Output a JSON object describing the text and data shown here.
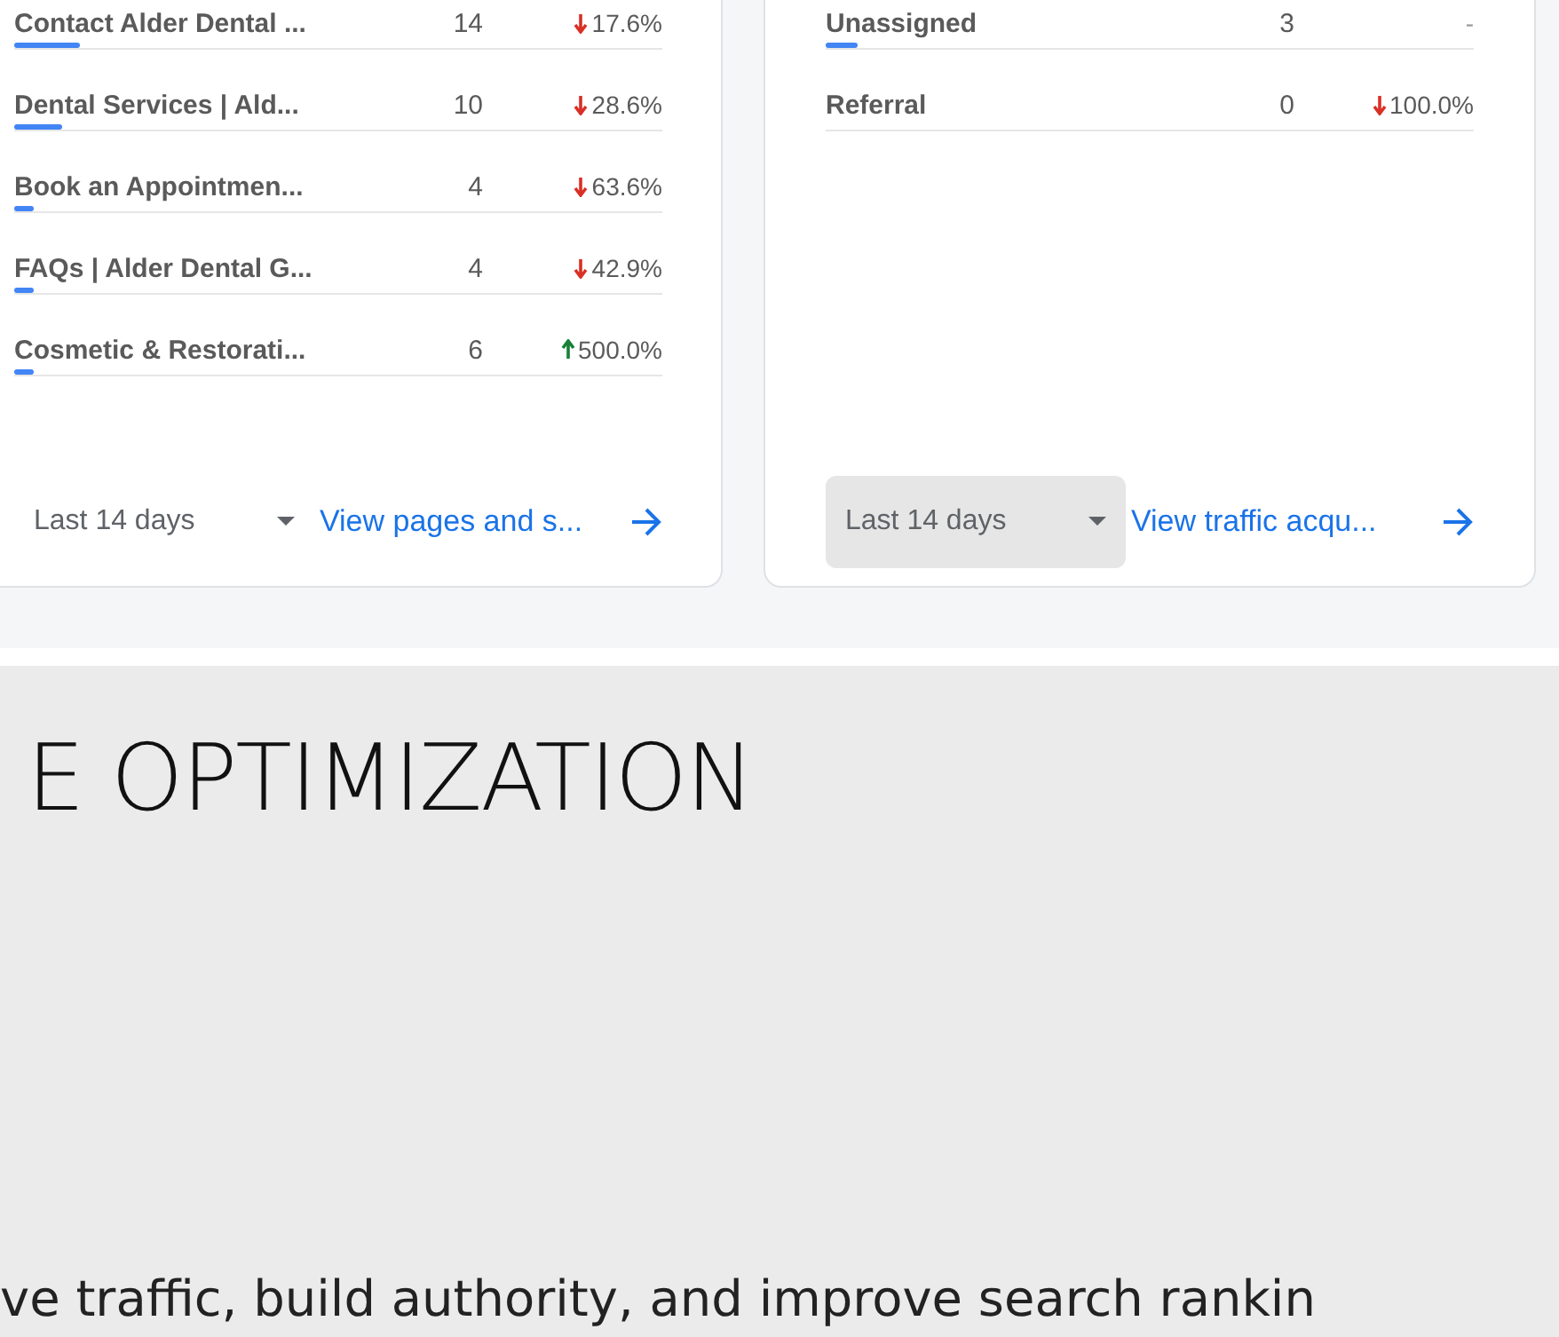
{
  "cards": [
    {
      "rows": [
        {
          "name": "Contact Alder Dental ...",
          "value": "14",
          "change": "17.6%",
          "kind": "down",
          "level": 0.1
        },
        {
          "name": "Dental Services | Ald...",
          "value": "10",
          "change": "28.6%",
          "kind": "down",
          "level": 0.075
        },
        {
          "name": "Book an Appointmen...",
          "value": "4",
          "change": "63.6%",
          "kind": "down",
          "level": 0.03
        },
        {
          "name": "FAQs | Alder Dental G...",
          "value": "4",
          "change": "42.9%",
          "kind": "down",
          "level": 0.03
        },
        {
          "name": "Cosmetic & Restorati...",
          "value": "6",
          "change": "500.0%",
          "kind": "up",
          "level": 0.03
        }
      ],
      "period": {
        "label": "Last 14 days",
        "highlighted": false
      },
      "link": "View pages and s..."
    },
    {
      "rows": [
        {
          "name": "Unassigned",
          "value": "3",
          "change": "-",
          "kind": "flat",
          "level": 0.05
        },
        {
          "name": "Referral",
          "value": "0",
          "change": "100.0%",
          "kind": "down",
          "level": 0
        }
      ],
      "period": {
        "label": "Last 14 days",
        "highlighted": true
      },
      "link": "View traffic acqu..."
    }
  ],
  "section": {
    "heading": "E OPTIMIZATION",
    "text": "ve traffic, build authority, and improve search rankin"
  }
}
